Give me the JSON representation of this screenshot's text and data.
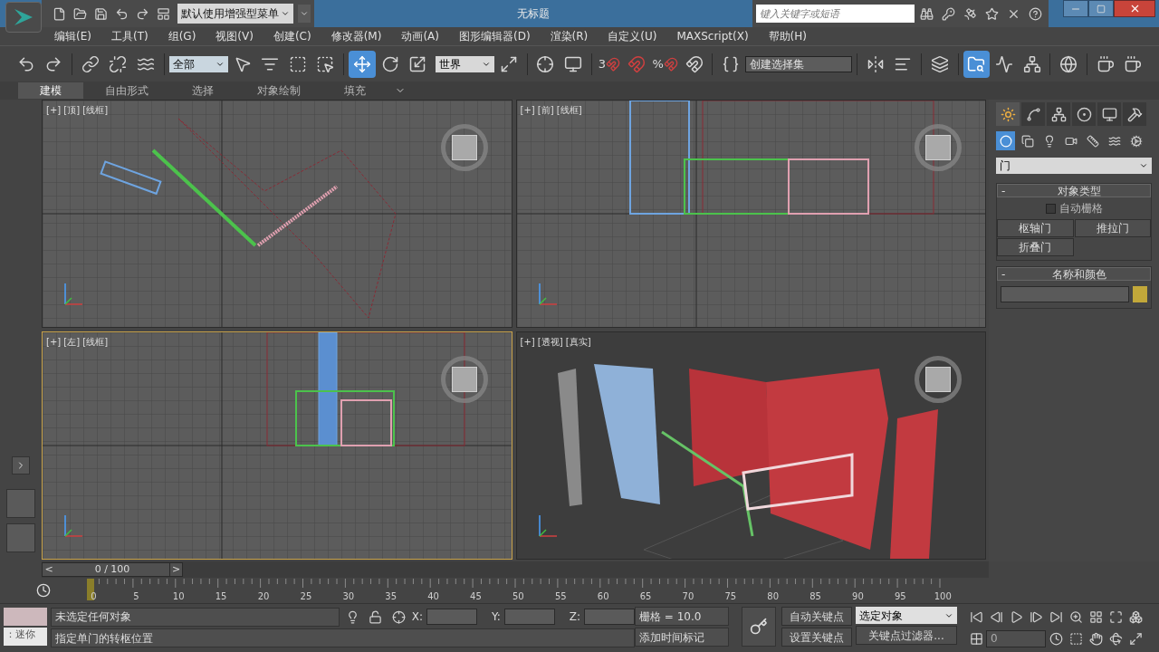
{
  "title_bar": {
    "workspace": "默认使用增强型菜单",
    "title": "无标题",
    "search": {
      "placeholder": "键入关键字或短语"
    }
  },
  "menu": [
    "编辑(E)",
    "工具(T)",
    "组(G)",
    "视图(V)",
    "创建(C)",
    "修改器(M)",
    "动画(A)",
    "图形编辑器(D)",
    "渲染(R)",
    "自定义(U)",
    "MAXScript(X)",
    "帮助(H)"
  ],
  "toolbar": {
    "selection_filter": "全部",
    "coordinate_system": "世界",
    "angle_snap_label": "3",
    "percent_snap_label": "%",
    "selection_set": {
      "placeholder": "创建选择集"
    },
    "transform_tools": [
      {
        "kind": "move",
        "selected": true
      },
      {
        "kind": "rotate",
        "selected": false
      },
      {
        "kind": "scale",
        "selected": false
      }
    ],
    "scene_explorer": {
      "selected": true
    }
  },
  "ribbon_tabs": [
    {
      "label": "建模",
      "selected": true
    },
    {
      "label": "自由形式",
      "selected": false
    },
    {
      "label": "选择",
      "selected": false
    },
    {
      "label": "对象绘制",
      "selected": false
    },
    {
      "label": "填充",
      "selected": false
    }
  ],
  "viewports": [
    {
      "kind": "top",
      "label": "[+] [顶] [线框]",
      "active": false
    },
    {
      "kind": "front",
      "label": "[+] [前] [线框]",
      "active": false
    },
    {
      "kind": "left",
      "label": "[+] [左] [线框]",
      "active": true
    },
    {
      "kind": "perspective",
      "label": "[+] [透视] [真实]",
      "active": false
    }
  ],
  "command_panel": {
    "tabs": [
      {
        "kind": "create",
        "selected": true
      },
      {
        "kind": "modify",
        "selected": false
      },
      {
        "kind": "hierarchy",
        "selected": false
      },
      {
        "kind": "motion",
        "selected": false
      },
      {
        "kind": "display",
        "selected": false
      },
      {
        "kind": "utilities",
        "selected": false
      }
    ],
    "categories": [
      {
        "kind": "geometry",
        "selected": true
      },
      {
        "kind": "shapes",
        "selected": false
      },
      {
        "kind": "lights",
        "selected": false
      },
      {
        "kind": "cameras",
        "selected": false
      },
      {
        "kind": "helpers",
        "selected": false
      },
      {
        "kind": "spacewarps",
        "selected": false
      },
      {
        "kind": "systems",
        "selected": false
      }
    ],
    "subcategory": "门",
    "object_type": {
      "collapse": "-",
      "title": "对象类型",
      "autogrid": {
        "label": "自动栅格",
        "checked": false
      },
      "buttons": [
        "枢轴门",
        "推拉门",
        "折叠门"
      ]
    },
    "name_color": {
      "collapse": "-",
      "title": "名称和颜色",
      "color": "#c2a83a"
    }
  },
  "timeline": {
    "position": "0 / 100",
    "prev": "<",
    "next": ">",
    "ticks": [
      "0",
      "5",
      "10",
      "15",
      "20",
      "25",
      "30",
      "35",
      "40",
      "45",
      "50",
      "55",
      "60",
      "65",
      "70",
      "75",
      "80",
      "85",
      "90",
      "95",
      "100"
    ]
  },
  "status": {
    "script_label": "：迷你",
    "selection": "未选定任何对象",
    "prompt": "指定单门的转枢位置",
    "x_label": "X:",
    "y_label": "Y:",
    "z_label": "Z:",
    "grid": "栅格 = 10.0",
    "time_tag": "添加时间标记",
    "auto_key": "自动关键点",
    "set_key": "设置关键点",
    "key_mode": "选定对象",
    "key_filters": "关键点过滤器...",
    "frame": "0"
  }
}
